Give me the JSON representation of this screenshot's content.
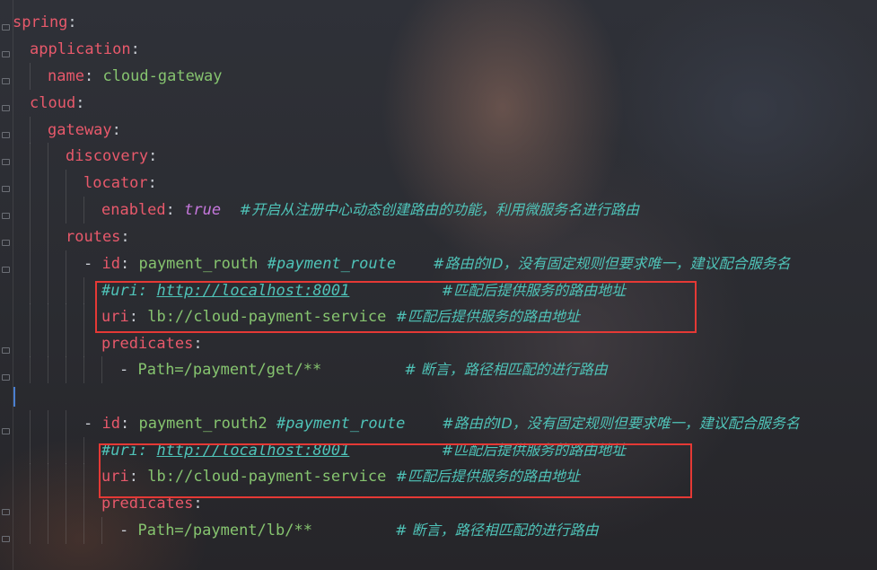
{
  "editor": {
    "lines": [
      {
        "key": "spring",
        "colon": ":"
      },
      {
        "key": "application",
        "colon": ":"
      },
      {
        "key": "name",
        "colon": ":",
        "value": "cloud-gateway"
      },
      {
        "key": "cloud",
        "colon": ":"
      },
      {
        "key": "gateway",
        "colon": ":"
      },
      {
        "key": "discovery",
        "colon": ":"
      },
      {
        "key": "locator",
        "colon": ":"
      },
      {
        "key": "enabled",
        "colon": ":",
        "kw": "true",
        "comment": "#开启从注册中心动态创建路由的功能，利用微服务名进行路由"
      },
      {
        "key": "routes",
        "colon": ":"
      },
      {
        "dash": "- ",
        "key": "id",
        "colon": ":",
        "value": "payment_routh",
        "comment_code": "#payment_route",
        "comment": "#路由的ID，没有固定规则但要求唯一，建议配合服务名"
      },
      {
        "comment_code": "#uri:",
        "link": "http://localhost:8001",
        "comment": "#匹配后提供服务的路由地址"
      },
      {
        "key": "uri",
        "colon": ":",
        "value": "lb://cloud-payment-service",
        "comment": "#匹配后提供服务的路由地址"
      },
      {
        "key": "predicates",
        "colon": ":"
      },
      {
        "dash": "- ",
        "value": "Path=/payment/get/**",
        "comment": "# 断言，路径相匹配的进行路由"
      },
      {},
      {
        "dash": "- ",
        "key": "id",
        "colon": ":",
        "value": "payment_routh2",
        "comment_code": "#payment_route",
        "comment": "#路由的ID，没有固定规则但要求唯一，建议配合服务名"
      },
      {
        "comment_code": "#uri:",
        "link": "http://localhost:8001",
        "comment": "#匹配后提供服务的路由地址"
      },
      {
        "key": "uri",
        "colon": ":",
        "value": "lb://cloud-payment-service",
        "comment": "#匹配后提供服务的路由地址"
      },
      {
        "key": "predicates",
        "colon": ":"
      },
      {
        "dash": "- ",
        "value": "Path=/payment/lb/**",
        "comment": "# 断言，路径相匹配的进行路由"
      }
    ]
  },
  "colors": {
    "key": "#e8596b",
    "string": "#86c46f",
    "comment": "#4fc3b8",
    "boolean": "#c678dd",
    "highlight_box": "#e53935"
  }
}
